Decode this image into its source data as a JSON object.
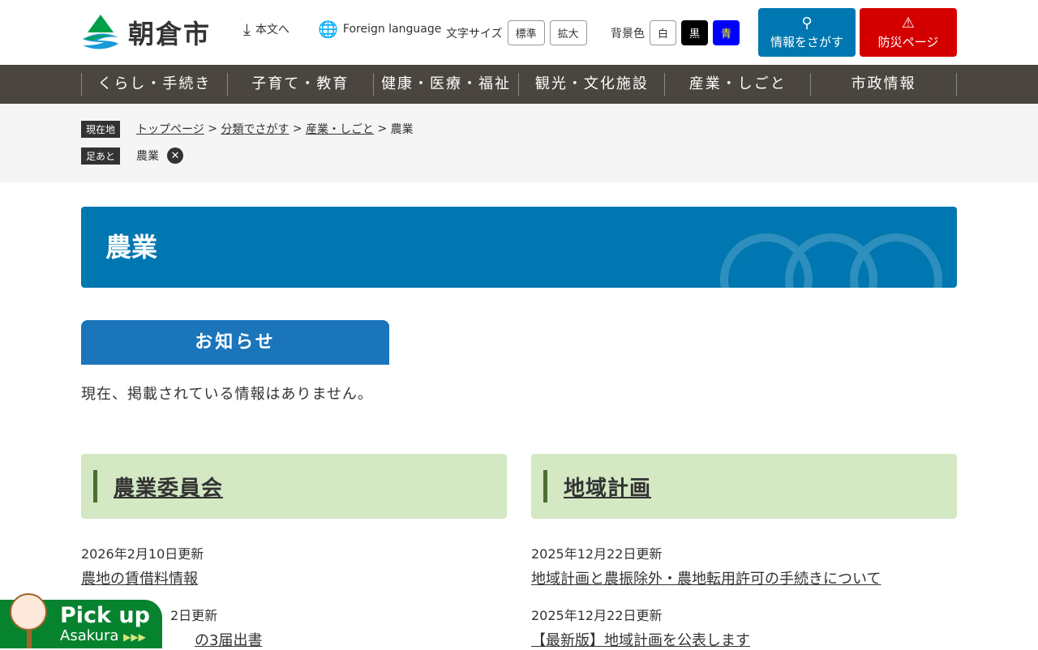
{
  "header": {
    "site_name": "朝倉市",
    "skip": "本文へ",
    "foreign": "Foreign language",
    "font_size_label": "文字サイズ",
    "font_standard": "標準",
    "font_large": "拡大",
    "bg_label": "背景色",
    "bg_white": "白",
    "bg_black": "黒",
    "bg_blue": "青",
    "search": "情報をさがす",
    "disaster": "防災ページ"
  },
  "nav": [
    "くらし・手続き",
    "子育て・教育",
    "健康・医療・福祉",
    "観光・文化施設",
    "産業・しごと",
    "市政情報"
  ],
  "breadcrumb": {
    "label": "現在地",
    "items": [
      "トップページ",
      "分類でさがす",
      "産業・しごと"
    ],
    "current": "農業",
    "sep": ">"
  },
  "footprint": {
    "label": "足あと",
    "item": "農業"
  },
  "page_title": "農業",
  "notice": {
    "heading": "お知らせ",
    "text": "現在、掲載されている情報はありません。"
  },
  "sections": [
    {
      "title": "農業委員会",
      "items": [
        {
          "date": "2026年2月10日更新",
          "title": "農地の賃借料情報"
        },
        {
          "date": "2日更新",
          "title": "の3届出書"
        }
      ]
    },
    {
      "title": "地域計画",
      "items": [
        {
          "date": "2025年12月22日更新",
          "title": "地域計画と農振除外・農地転用許可の手続きについて"
        },
        {
          "date": "2025年12月22日更新",
          "title": "【最新版】地域計画を公表します"
        }
      ]
    }
  ],
  "pickup": {
    "line1": "Pick up",
    "line2": "Asakura"
  },
  "colors": {
    "nav": "#4a453e",
    "title": "#0077b0",
    "search": "#0077b0",
    "disaster": "#d40000",
    "section": "#d3e8c3",
    "pickup": "#07832f"
  }
}
